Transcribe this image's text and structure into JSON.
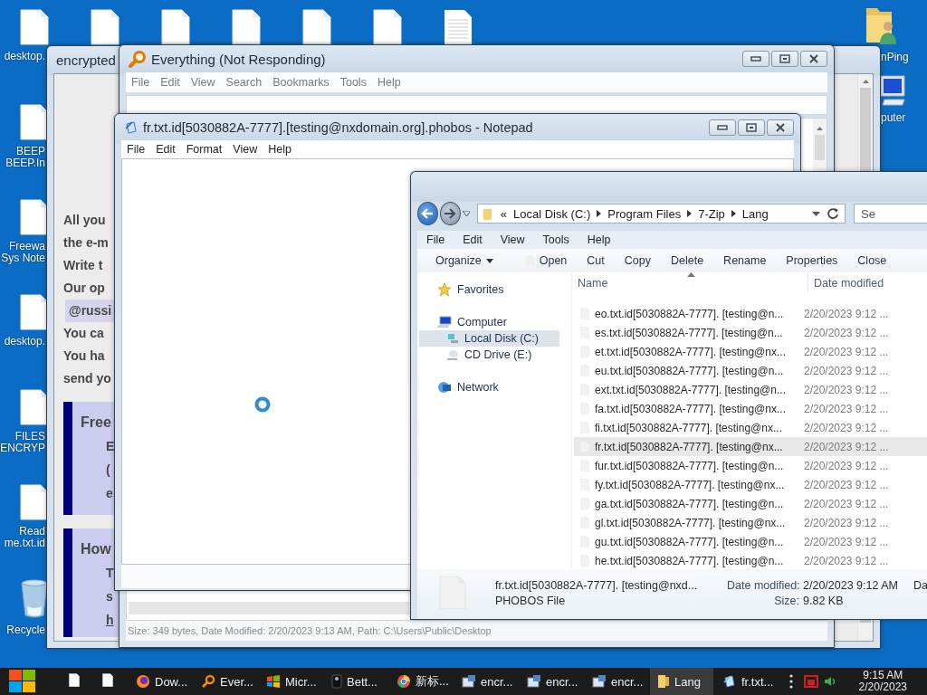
{
  "desktop": {
    "top_icons": [
      {
        "kind": "file",
        "label": [
          "desktop."
        ]
      },
      {
        "kind": "file"
      },
      {
        "kind": "file"
      },
      {
        "kind": "file"
      },
      {
        "kind": "file"
      },
      {
        "kind": "file"
      },
      {
        "kind": "document"
      }
    ],
    "left_icons": [
      {
        "kind": "file",
        "label": [
          "BEEP",
          "BEEP.In"
        ]
      },
      {
        "kind": "file",
        "label": [
          "Freewa",
          "Sys Note"
        ]
      },
      {
        "kind": "file",
        "label": [
          "desktop."
        ]
      },
      {
        "kind": "file",
        "label": [
          "FILES",
          "ENCRYP"
        ]
      },
      {
        "kind": "file",
        "label": [
          "Read",
          "me.txt.id"
        ]
      },
      {
        "kind": "recycle",
        "label": [
          "Recycle"
        ]
      }
    ],
    "right_icons": [
      {
        "kind": "user-folder",
        "label": [
          "nPing"
        ]
      },
      {
        "kind": "computer",
        "label": [
          "puter"
        ]
      }
    ]
  },
  "ransom_window": {
    "title": "encrypted",
    "lines": [
      {
        "text": "All you",
        "kind": "plain"
      },
      {
        "text": "the e-m",
        "kind": "plain"
      },
      {
        "text": "Write t",
        "kind": "plain"
      },
      {
        "text": "Our op",
        "kind": "plain"
      },
      {
        "text": "@russi",
        "kind": "highlight"
      },
      {
        "text": "You ca",
        "kind": "plain"
      },
      {
        "text": "You ha",
        "kind": "plain"
      },
      {
        "text": "send yo",
        "kind": "plain"
      }
    ],
    "boxes": [
      {
        "heading": "Free",
        "lines": [
          {
            "text": "E",
            "kind": "plain"
          },
          {
            "text": "(",
            "kind": "plain"
          },
          {
            "text": "e",
            "kind": "plain"
          }
        ]
      },
      {
        "heading": "How",
        "lines": [
          {
            "text": "T",
            "kind": "plain"
          },
          {
            "text": "s",
            "kind": "plain"
          },
          {
            "text": "h",
            "kind": "link"
          }
        ]
      }
    ]
  },
  "everything_window": {
    "title": "Everything (Not Responding)",
    "menu": [
      "File",
      "Edit",
      "View",
      "Search",
      "Bookmarks",
      "Tools",
      "Help"
    ],
    "status_bar": "Size: 349 bytes, Date Modified: 2/20/2023 9:13 AM, Path: C:\\Users\\Public\\Desktop"
  },
  "notepad_window": {
    "title": "fr.txt.id[5030882A-7777].[testing@nxdomain.org].phobos - Notepad",
    "menu": [
      "File",
      "Edit",
      "Format",
      "View",
      "Help"
    ]
  },
  "explorer_window": {
    "address_chevron": "«",
    "path": [
      "Local Disk (C:)",
      "Program Files",
      "7-Zip",
      "Lang"
    ],
    "search": {
      "placeholder": "Se"
    },
    "menu": [
      "File",
      "Edit",
      "View",
      "Tools",
      "Help"
    ],
    "toolbar": [
      {
        "label": "Organize",
        "kind": "dropdown"
      },
      {
        "label": "Open",
        "kind": "icon"
      },
      {
        "label": "Cut",
        "kind": "plain"
      },
      {
        "label": "Copy",
        "kind": "plain"
      },
      {
        "label": "Delete",
        "kind": "plain"
      },
      {
        "label": "Rename",
        "kind": "plain"
      },
      {
        "label": "Properties",
        "kind": "plain"
      },
      {
        "label": "Close",
        "kind": "plain"
      }
    ],
    "nav_pane": [
      {
        "label": "Favorites",
        "kind": "star",
        "selected": false
      },
      {
        "label": "Computer",
        "kind": "computer",
        "selected": false,
        "children": [
          {
            "label": "Local Disk (C:)",
            "kind": "disk",
            "selected": true
          },
          {
            "label": "CD Drive (E:)",
            "kind": "cd",
            "selected": false
          }
        ]
      },
      {
        "label": "Network",
        "kind": "network",
        "selected": false
      }
    ],
    "columns": [
      {
        "label": "Name",
        "sorted": true
      },
      {
        "label": "Date modified",
        "sorted": false
      }
    ],
    "files": [
      {
        "name": "eo.txt.id[5030882A-7777]. [testing@n...",
        "date": "2/20/2023 9:12 ...",
        "selected": false
      },
      {
        "name": "es.txt.id[5030882A-7777]. [testing@n...",
        "date": "2/20/2023 9:12 ...",
        "selected": false
      },
      {
        "name": "et.txt.id[5030882A-7777]. [testing@nx...",
        "date": "2/20/2023 9:12 ...",
        "selected": false
      },
      {
        "name": "eu.txt.id[5030882A-7777]. [testing@n...",
        "date": "2/20/2023 9:12 ...",
        "selected": false
      },
      {
        "name": "ext.txt.id[5030882A-7777]. [testing@n...",
        "date": "2/20/2023 9:12 ...",
        "selected": false
      },
      {
        "name": "fa.txt.id[5030882A-7777]. [testing@nx...",
        "date": "2/20/2023 9:12 ...",
        "selected": false
      },
      {
        "name": "fi.txt.id[5030882A-7777]. [testing@nx...",
        "date": "2/20/2023 9:12 ...",
        "selected": false
      },
      {
        "name": "fr.txt.id[5030882A-7777]. [testing@nx...",
        "date": "2/20/2023 9:12 ...",
        "selected": true
      },
      {
        "name": "fur.txt.id[5030882A-7777]. [testing@n...",
        "date": "2/20/2023 9:12 ...",
        "selected": false
      },
      {
        "name": "fy.txt.id[5030882A-7777]. [testing@nx...",
        "date": "2/20/2023 9:12 ...",
        "selected": false
      },
      {
        "name": "ga.txt.id[5030882A-7777]. [testing@n...",
        "date": "2/20/2023 9:12 ...",
        "selected": false
      },
      {
        "name": "gl.txt.id[5030882A-7777]. [testing@nx...",
        "date": "2/20/2023 9:12 ...",
        "selected": false
      },
      {
        "name": "gu.txt.id[5030882A-7777]. [testing@n...",
        "date": "2/20/2023 9:12 ...",
        "selected": false
      },
      {
        "name": "he.txt.id[5030882A-7777]. [testing@n...",
        "date": "2/20/2023 9:12 ...",
        "selected": false
      }
    ],
    "details": {
      "name": "fr.txt.id[5030882A-7777]. [testing@nxd...",
      "type": "PHOBOS File",
      "fields": [
        {
          "label": "Date modified:",
          "value": "2/20/2023 9:12 AM"
        },
        {
          "label": "Size:",
          "value": "9.82 KB"
        }
      ],
      "column_3": "Da"
    }
  },
  "taskbar": {
    "pinned": [
      {
        "kind": "file"
      },
      {
        "kind": "file"
      }
    ],
    "buttons": [
      {
        "label": "Dow...",
        "kind": "fox",
        "selected": false
      },
      {
        "label": "Ever...",
        "kind": "search",
        "selected": false
      },
      {
        "label": "Micr...",
        "kind": "tiles",
        "selected": false
      },
      {
        "label": "Bett...",
        "kind": "dark",
        "selected": false
      },
      {
        "label": "新标...",
        "kind": "globe",
        "selected": false
      },
      {
        "label": "encr...",
        "kind": "app",
        "selected": false
      },
      {
        "label": "encr...",
        "kind": "app",
        "selected": false
      },
      {
        "label": "encr...",
        "kind": "app",
        "selected": false
      },
      {
        "label": "Lang",
        "kind": "folder",
        "selected": true
      },
      {
        "label": "fr.txt...",
        "kind": "notepad",
        "selected": false
      }
    ],
    "clock": {
      "time": "9:15 AM",
      "date": "2/20/2023"
    }
  }
}
